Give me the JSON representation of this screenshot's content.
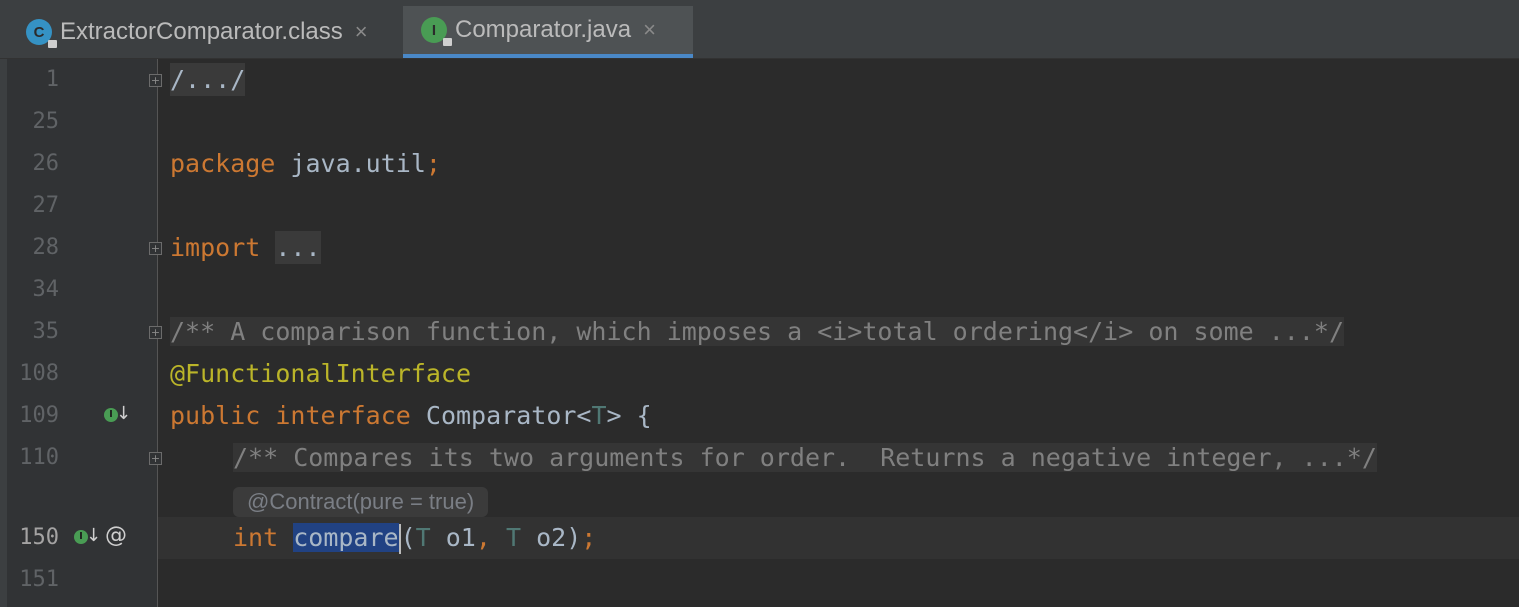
{
  "tabs": [
    {
      "label": "ExtractorComparator.class",
      "icon_letter": "C",
      "icon_color": "#3592c4",
      "close": "×",
      "active": false
    },
    {
      "label": "Comparator.java",
      "icon_letter": "I",
      "icon_color": "#499c54",
      "close": "×",
      "active": true
    }
  ],
  "line_numbers": [
    "1",
    "25",
    "26",
    "27",
    "28",
    "34",
    "35",
    "108",
    "109",
    "110",
    "150",
    "151"
  ],
  "code": {
    "header_fold": "/.../",
    "package_kw": "package",
    "package_name": " java.util",
    "semicolon": ";",
    "import_kw": "import",
    "import_fold": "...",
    "doc1": "/** A comparison function, which imposes a <i>total ordering</i> on some ...*/",
    "annotation": "@FunctionalInterface",
    "public_kw": "public",
    "interface_kw": "interface",
    "iface_name": "Comparator<",
    "type_param": "T",
    "iface_end": "> {",
    "doc2": "/** Compares its two arguments for order.  Returns a negative integer, ...*/",
    "inlay_hint": "@Contract(pure = true)",
    "int_kw": "int",
    "method_name": "compare",
    "paren_open": "(",
    "param_type1": "T",
    "param1": " o1",
    "comma": ",",
    "param_type2": "T",
    "param2": " o2)",
    "end_semicolon": ";"
  },
  "gutter_icons": {
    "impl_icon_letter": "I",
    "down_arrow": "↓",
    "at_sign": "@"
  },
  "colors": {
    "background": "#2b2b2b",
    "keyword": "#cc7832",
    "annotation": "#bbb529",
    "comment": "#808080",
    "selection": "#214283",
    "active_tab_underline": "#4a88c7"
  }
}
